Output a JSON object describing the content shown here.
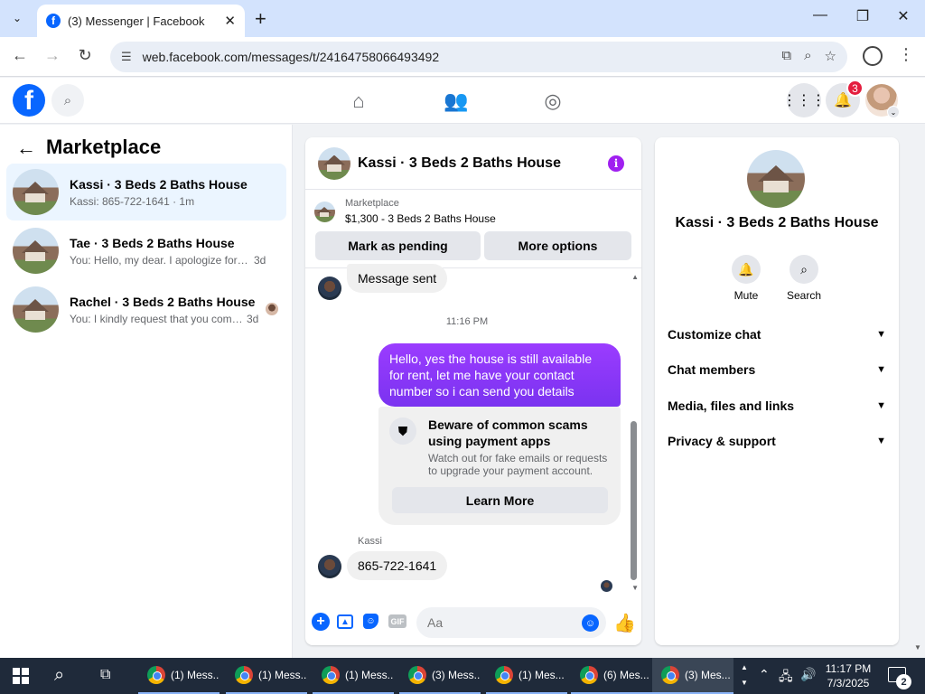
{
  "browser": {
    "tab_title": "(3) Messenger | Facebook",
    "url": "web.facebook.com/messages/t/24164758066493492"
  },
  "header": {
    "notification_count": "3"
  },
  "sidebar": {
    "title": "Marketplace",
    "conversations": [
      {
        "name": "Kassi · 3 Beds 2 Baths House",
        "snippet": "Kassi: 865-722-1641 · 1m",
        "time": ""
      },
      {
        "name": "Tae · 3 Beds 2 Baths House",
        "snippet": "You: Hello, my dear. I apologize for no...",
        "time": "3d"
      },
      {
        "name": "Rachel · 3 Beds 2 Baths House",
        "snippet": "You: I kindly request that you comp...",
        "time": "3d"
      }
    ]
  },
  "chat": {
    "title": "Kassi · 3 Beds 2 Baths House",
    "listing_category": "Marketplace",
    "listing_price": "$1,300 - 3 Beds 2 Baths House",
    "mark_pending_label": "Mark as pending",
    "more_options_label": "More options",
    "msg_sent": "Message sent",
    "time_label": "11:16 PM",
    "outgoing_message": "Hello, yes the house is still available for rent, let me have your contact number so i can send you  details",
    "scam_title": "Beware of common scams using payment apps",
    "scam_body": "Watch out for fake emails or requests to upgrade your payment account.",
    "learn_more_label": "Learn More",
    "sender_name": "Kassi",
    "incoming_message": "865-722-1641",
    "input_placeholder": "Aa"
  },
  "info_panel": {
    "title": "Kassi · 3 Beds 2 Baths House",
    "mute_label": "Mute",
    "search_label": "Search",
    "sections": [
      "Customize chat",
      "Chat members",
      "Media, files and links",
      "Privacy & support"
    ]
  },
  "taskbar": {
    "apps": [
      "(1) Mess...",
      "(1) Mess...",
      "(1) Mess...",
      "(3) Mess...",
      "(1) Mes...",
      "(6) Mes...",
      "(3) Mes..."
    ],
    "time": "11:17 PM",
    "date": "7/3/2025",
    "notification_count": "2"
  },
  "colors": {
    "fb_blue": "#0866ff",
    "outgoing_bubble": "#9b3cff",
    "active_conversation": "#ebf5ff",
    "notification_red": "#e41e3f"
  },
  "icons": [
    "facebook-logo",
    "search-icon",
    "home-icon",
    "friends-icon",
    "groups-icon",
    "menu-grid-icon",
    "bell-icon",
    "info-icon",
    "shield-icon",
    "plus-icon",
    "photo-icon",
    "sticker-icon",
    "gif-icon",
    "emoji-icon",
    "like-icon"
  ]
}
